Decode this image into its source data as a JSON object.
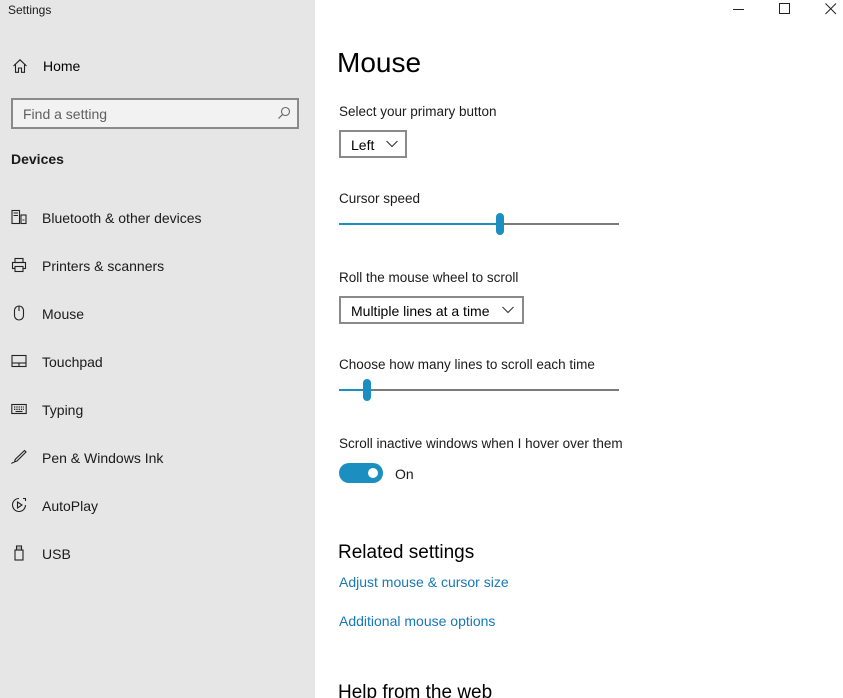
{
  "window": {
    "app_title": "Settings"
  },
  "sidebar": {
    "home_label": "Home",
    "search_placeholder": "Find a setting",
    "section_heading": "Devices",
    "items": [
      {
        "label": "Bluetooth & other devices",
        "icon": "bluetooth-devices-icon"
      },
      {
        "label": "Printers & scanners",
        "icon": "printer-icon"
      },
      {
        "label": "Mouse",
        "icon": "mouse-icon"
      },
      {
        "label": "Touchpad",
        "icon": "touchpad-icon"
      },
      {
        "label": "Typing",
        "icon": "keyboard-icon"
      },
      {
        "label": "Pen & Windows Ink",
        "icon": "pen-icon"
      },
      {
        "label": "AutoPlay",
        "icon": "autoplay-icon"
      },
      {
        "label": "USB",
        "icon": "usb-icon"
      }
    ]
  },
  "main": {
    "title": "Mouse",
    "primary_button": {
      "label": "Select your primary button",
      "value": "Left"
    },
    "cursor_speed": {
      "label": "Cursor speed",
      "value_fraction": 0.575
    },
    "wheel_scroll": {
      "label": "Roll the mouse wheel to scroll",
      "value": "Multiple lines at a time"
    },
    "lines_to_scroll": {
      "label": "Choose how many lines to scroll each time",
      "value_fraction": 0.1
    },
    "scroll_inactive": {
      "label": "Scroll inactive windows when I hover over them",
      "state": "On",
      "enabled": true
    },
    "related": {
      "heading": "Related settings",
      "links": [
        "Adjust mouse & cursor size",
        "Additional mouse options"
      ]
    },
    "help": {
      "heading": "Help from the web"
    }
  },
  "colors": {
    "accent": "#1c8fc1",
    "link": "#1878b8",
    "sidebar_bg": "#e6e6e6"
  }
}
